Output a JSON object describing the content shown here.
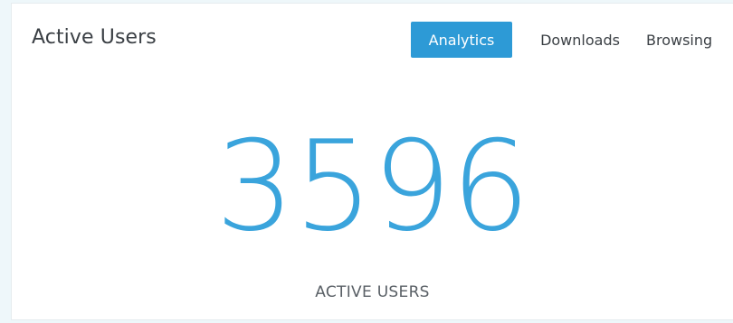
{
  "card": {
    "title": "Active Users"
  },
  "tabs": [
    {
      "label": "Analytics",
      "active": true
    },
    {
      "label": "Downloads",
      "active": false
    },
    {
      "label": "Browsing",
      "active": false
    }
  ],
  "metric": {
    "value": "3596",
    "label": "ACTIVE USERS"
  },
  "colors": {
    "accent": "#2d9ad6",
    "metric": "#3aa4dc",
    "text": "#3a3f44",
    "background": "#eef7fa"
  }
}
